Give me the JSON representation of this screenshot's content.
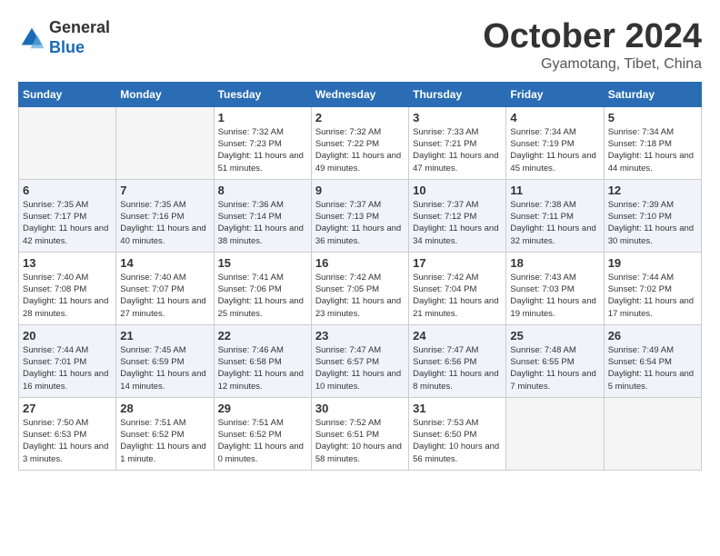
{
  "header": {
    "logo_line1": "General",
    "logo_line2": "Blue",
    "month_title": "October 2024",
    "subtitle": "Gyamotang, Tibet, China"
  },
  "weekdays": [
    "Sunday",
    "Monday",
    "Tuesday",
    "Wednesday",
    "Thursday",
    "Friday",
    "Saturday"
  ],
  "weeks": [
    [
      {
        "day": "",
        "empty": true
      },
      {
        "day": "",
        "empty": true
      },
      {
        "day": "1",
        "sunrise": "7:32 AM",
        "sunset": "7:23 PM",
        "daylight": "11 hours and 51 minutes."
      },
      {
        "day": "2",
        "sunrise": "7:32 AM",
        "sunset": "7:22 PM",
        "daylight": "11 hours and 49 minutes."
      },
      {
        "day": "3",
        "sunrise": "7:33 AM",
        "sunset": "7:21 PM",
        "daylight": "11 hours and 47 minutes."
      },
      {
        "day": "4",
        "sunrise": "7:34 AM",
        "sunset": "7:19 PM",
        "daylight": "11 hours and 45 minutes."
      },
      {
        "day": "5",
        "sunrise": "7:34 AM",
        "sunset": "7:18 PM",
        "daylight": "11 hours and 44 minutes."
      }
    ],
    [
      {
        "day": "6",
        "sunrise": "7:35 AM",
        "sunset": "7:17 PM",
        "daylight": "11 hours and 42 minutes."
      },
      {
        "day": "7",
        "sunrise": "7:35 AM",
        "sunset": "7:16 PM",
        "daylight": "11 hours and 40 minutes."
      },
      {
        "day": "8",
        "sunrise": "7:36 AM",
        "sunset": "7:14 PM",
        "daylight": "11 hours and 38 minutes."
      },
      {
        "day": "9",
        "sunrise": "7:37 AM",
        "sunset": "7:13 PM",
        "daylight": "11 hours and 36 minutes."
      },
      {
        "day": "10",
        "sunrise": "7:37 AM",
        "sunset": "7:12 PM",
        "daylight": "11 hours and 34 minutes."
      },
      {
        "day": "11",
        "sunrise": "7:38 AM",
        "sunset": "7:11 PM",
        "daylight": "11 hours and 32 minutes."
      },
      {
        "day": "12",
        "sunrise": "7:39 AM",
        "sunset": "7:10 PM",
        "daylight": "11 hours and 30 minutes."
      }
    ],
    [
      {
        "day": "13",
        "sunrise": "7:40 AM",
        "sunset": "7:08 PM",
        "daylight": "11 hours and 28 minutes."
      },
      {
        "day": "14",
        "sunrise": "7:40 AM",
        "sunset": "7:07 PM",
        "daylight": "11 hours and 27 minutes."
      },
      {
        "day": "15",
        "sunrise": "7:41 AM",
        "sunset": "7:06 PM",
        "daylight": "11 hours and 25 minutes."
      },
      {
        "day": "16",
        "sunrise": "7:42 AM",
        "sunset": "7:05 PM",
        "daylight": "11 hours and 23 minutes."
      },
      {
        "day": "17",
        "sunrise": "7:42 AM",
        "sunset": "7:04 PM",
        "daylight": "11 hours and 21 minutes."
      },
      {
        "day": "18",
        "sunrise": "7:43 AM",
        "sunset": "7:03 PM",
        "daylight": "11 hours and 19 minutes."
      },
      {
        "day": "19",
        "sunrise": "7:44 AM",
        "sunset": "7:02 PM",
        "daylight": "11 hours and 17 minutes."
      }
    ],
    [
      {
        "day": "20",
        "sunrise": "7:44 AM",
        "sunset": "7:01 PM",
        "daylight": "11 hours and 16 minutes."
      },
      {
        "day": "21",
        "sunrise": "7:45 AM",
        "sunset": "6:59 PM",
        "daylight": "11 hours and 14 minutes."
      },
      {
        "day": "22",
        "sunrise": "7:46 AM",
        "sunset": "6:58 PM",
        "daylight": "11 hours and 12 minutes."
      },
      {
        "day": "23",
        "sunrise": "7:47 AM",
        "sunset": "6:57 PM",
        "daylight": "11 hours and 10 minutes."
      },
      {
        "day": "24",
        "sunrise": "7:47 AM",
        "sunset": "6:56 PM",
        "daylight": "11 hours and 8 minutes."
      },
      {
        "day": "25",
        "sunrise": "7:48 AM",
        "sunset": "6:55 PM",
        "daylight": "11 hours and 7 minutes."
      },
      {
        "day": "26",
        "sunrise": "7:49 AM",
        "sunset": "6:54 PM",
        "daylight": "11 hours and 5 minutes."
      }
    ],
    [
      {
        "day": "27",
        "sunrise": "7:50 AM",
        "sunset": "6:53 PM",
        "daylight": "11 hours and 3 minutes."
      },
      {
        "day": "28",
        "sunrise": "7:51 AM",
        "sunset": "6:52 PM",
        "daylight": "11 hours and 1 minute."
      },
      {
        "day": "29",
        "sunrise": "7:51 AM",
        "sunset": "6:52 PM",
        "daylight": "11 hours and 0 minutes."
      },
      {
        "day": "30",
        "sunrise": "7:52 AM",
        "sunset": "6:51 PM",
        "daylight": "10 hours and 58 minutes."
      },
      {
        "day": "31",
        "sunrise": "7:53 AM",
        "sunset": "6:50 PM",
        "daylight": "10 hours and 56 minutes."
      },
      {
        "day": "",
        "empty": true
      },
      {
        "day": "",
        "empty": true
      }
    ]
  ]
}
